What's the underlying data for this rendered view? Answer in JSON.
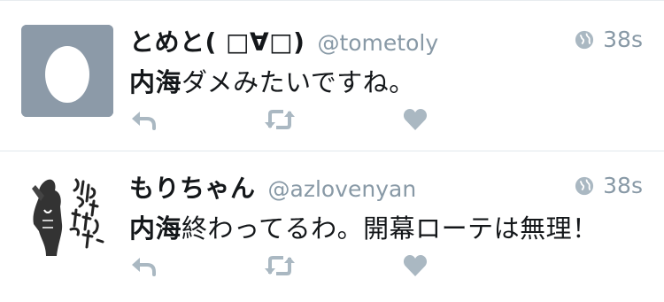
{
  "tweets": [
    {
      "display_name": "とめと( □∀□)",
      "handle": "@tometoly",
      "time": "38s",
      "text_bold": "内海",
      "text_rest": "ダメみたいですね。",
      "avatar": "default-egg-avatar"
    },
    {
      "display_name": "もりちゃん",
      "handle": "@azlovenyan",
      "time": "38s",
      "text_bold": "内海",
      "text_rest": "終わってるわ。開幕ローテは無理！",
      "avatar": "manga-illustration-avatar"
    }
  ],
  "icons": {
    "reply": "reply-icon",
    "retweet": "retweet-icon",
    "like": "heart-icon",
    "globe": "globe-icon"
  },
  "colors": {
    "icon_gray": "#aab8c2",
    "meta_gray": "#8899a6",
    "egg_background": "#8c9aa8"
  }
}
